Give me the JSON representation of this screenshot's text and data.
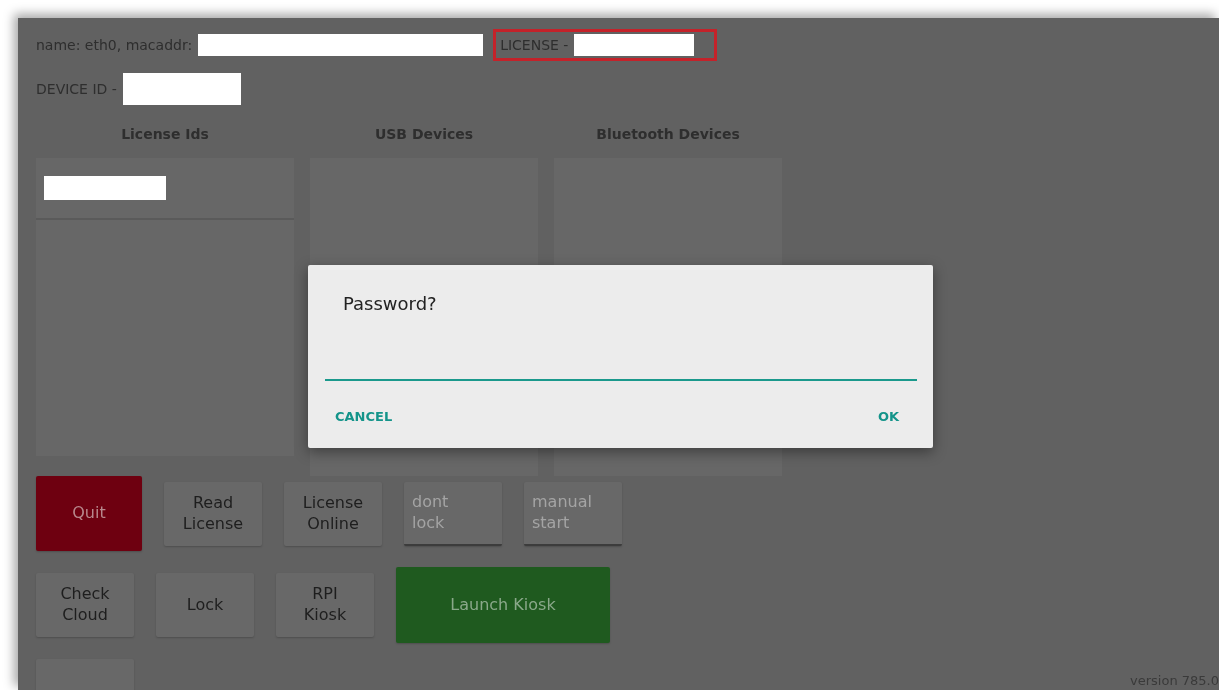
{
  "header": {
    "interface_label": "name: eth0, macaddr:",
    "license_label": "LICENSE -",
    "license_highlighted": true,
    "device_label": "DEVICE ID -"
  },
  "lists": [
    {
      "title": "License Ids",
      "items": [
        {
          "redacted": true
        }
      ]
    },
    {
      "title": "USB Devices"
    },
    {
      "title": "Bluetooth Devices"
    }
  ],
  "button_rows": [
    [
      {
        "label": "Quit",
        "kind": "danger"
      },
      {
        "label": "Read\nLicense",
        "kind": "plain"
      },
      {
        "label": "License\nOnline",
        "kind": "plain"
      },
      {
        "label": "dont\nlock",
        "kind": "toggle",
        "checked": false
      },
      {
        "label": "manual\nstart",
        "kind": "toggle",
        "checked": false
      }
    ],
    [
      {
        "label": "Check\nCloud",
        "kind": "plain"
      },
      {
        "label": "Lock",
        "kind": "plain"
      },
      {
        "label": "RPI\nKiosk",
        "kind": "plain"
      },
      {
        "label": "Launch Kiosk",
        "kind": "success"
      }
    ],
    [
      {
        "kind": "plain"
      }
    ]
  ],
  "version": "version 785.0",
  "dialog": {
    "title": "Password?",
    "buttons": [
      "CANCEL",
      "OK"
    ]
  }
}
